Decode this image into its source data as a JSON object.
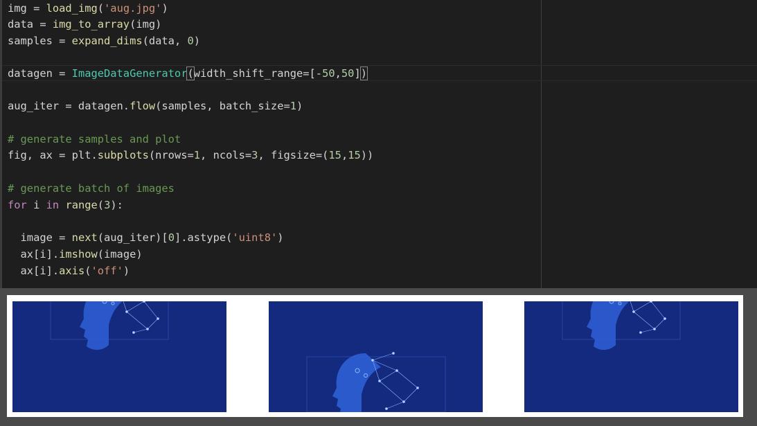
{
  "code": {
    "l1": {
      "a": "img = ",
      "b": "load_img",
      "c": "(",
      "d": "'aug.jpg'",
      "e": ")"
    },
    "l2": {
      "a": "data = ",
      "b": "img_to_array",
      "c": "(img)"
    },
    "l3": {
      "a": "samples = ",
      "b": "expand_dims",
      "c": "(data, ",
      "d": "0",
      ")": ")",
      "e": ")"
    },
    "l4": {
      "a": "datagen = ",
      "b": "ImageDataGenerator",
      "c": "(",
      "d": "width_shift_range=[-",
      "e": "50",
      ",": ",",
      "f": "50",
      "g": "]",
      ")": ")"
    },
    "l5": {
      "a": "aug_iter = datagen.",
      "b": "flow",
      "c": "(samples, batch_size=",
      "d": "1",
      "e": ")"
    },
    "l6": {
      "a": "# generate samples and plot"
    },
    "l7": {
      "a": "fig, ax = plt.",
      "b": "subplots",
      "c": "(nrows=",
      "d": "1",
      "e": ", ncols=",
      "f": "3",
      "g": ", figsize=(",
      "h": "15",
      "i": ",",
      "j": "15",
      "k": "))"
    },
    "l8": {
      "a": "# generate batch of images"
    },
    "l9": {
      "a": "for",
      "b": " i ",
      "c": "in",
      "d": " ",
      "e": "range",
      "f": "(",
      "g": "3",
      "h": "):"
    },
    "l10": {
      "a": "  image = ",
      "b": "next",
      "c": "(aug_iter)[",
      "d": "0",
      "e": "].astype(",
      "f": "'uint8'",
      "g": ")"
    },
    "l11": {
      "a": "  ax[i].",
      "b": "imshow",
      "c": "(image)"
    },
    "l12": {
      "a": "  ax[i].",
      "b": "axis",
      "c": "(",
      "d": "'off'",
      "e": ")"
    }
  },
  "output": {
    "images": [
      {
        "name": "augmented-image-1",
        "shift": "up-left"
      },
      {
        "name": "augmented-image-2",
        "shift": "down"
      },
      {
        "name": "augmented-image-3",
        "shift": "up-right"
      }
    ],
    "colors": {
      "bg": "#132a7e",
      "face": "#2f5fd6",
      "lines": "#8fb4ff"
    }
  }
}
